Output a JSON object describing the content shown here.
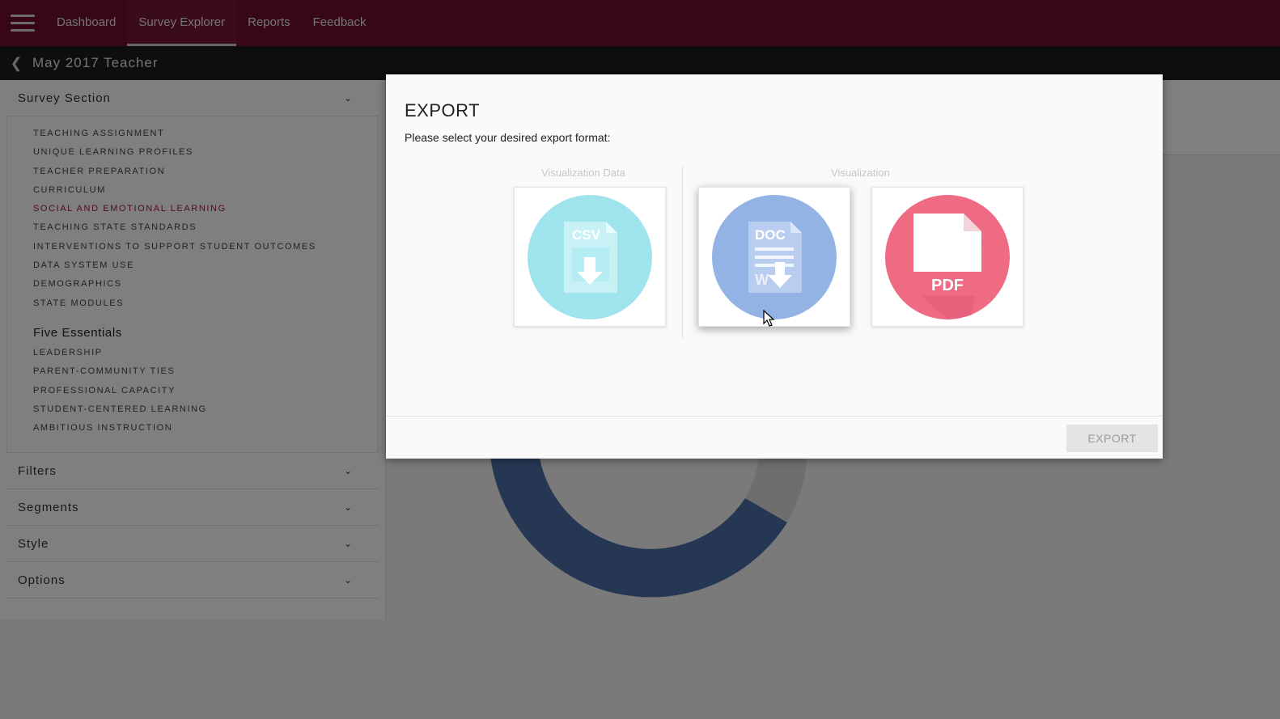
{
  "nav": {
    "items": [
      {
        "label": "Dashboard",
        "active": false
      },
      {
        "label": "Survey Explorer",
        "active": true
      },
      {
        "label": "Reports",
        "active": false
      },
      {
        "label": "Feedback",
        "active": false
      }
    ]
  },
  "titlebar": {
    "title": "May 2017 Teacher"
  },
  "sidebar": {
    "survey_section": {
      "label": "Survey Section",
      "items": [
        {
          "label": "TEACHING ASSIGNMENT"
        },
        {
          "label": "UNIQUE LEARNING PROFILES"
        },
        {
          "label": "TEACHER PREPARATION"
        },
        {
          "label": "CURRICULUM"
        },
        {
          "label": "SOCIAL AND EMOTIONAL LEARNING",
          "active": true
        },
        {
          "label": "TEACHING STATE STANDARDS"
        },
        {
          "label": "INTERVENTIONS TO SUPPORT STUDENT OUTCOMES"
        },
        {
          "label": "DATA SYSTEM USE"
        },
        {
          "label": "DEMOGRAPHICS"
        },
        {
          "label": "STATE MODULES"
        }
      ],
      "group_label": "Five Essentials",
      "group_items": [
        {
          "label": "LEADERSHIP"
        },
        {
          "label": "PARENT-COMMUNITY TIES"
        },
        {
          "label": "PROFESSIONAL CAPACITY"
        },
        {
          "label": "STUDENT-CENTERED LEARNING"
        },
        {
          "label": "AMBITIOUS INSTRUCTION"
        }
      ]
    },
    "filters_label": "Filters",
    "segments_label": "Segments",
    "style_label": "Style",
    "options_label": "Options"
  },
  "modal": {
    "title": "EXPORT",
    "subtitle": "Please select your desired export format:",
    "group_data_label": "Visualization Data",
    "group_vis_label": "Visualization",
    "formats": {
      "csv": "CSV",
      "doc": "DOC",
      "doc_mark": "W",
      "pdf": "PDF"
    },
    "export_button": "EXPORT"
  },
  "colors": {
    "nav_bg": "#6f0e2b",
    "accent": "#a0174a",
    "csv": "#9fe3ec",
    "doc": "#93b3e4",
    "pdf": "#ef6b84"
  }
}
